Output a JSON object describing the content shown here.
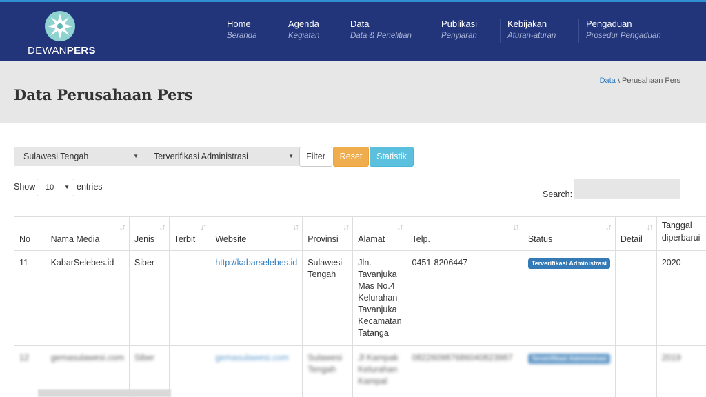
{
  "header": {
    "logo": {
      "light": "DEWAN",
      "bold": "PERS"
    },
    "nav": [
      {
        "title": "Home",
        "sub": "Beranda"
      },
      {
        "title": "Agenda",
        "sub": "Kegiatan"
      },
      {
        "title": "Data",
        "sub": "Data & Penelitian"
      },
      {
        "title": "Publikasi",
        "sub": "Penyiaran"
      },
      {
        "title": "Kebijakan",
        "sub": "Aturan-aturan"
      },
      {
        "title": "Pengaduan",
        "sub": "Prosedur Pengaduan"
      }
    ]
  },
  "page": {
    "title": "Data Perusahaan Pers",
    "breadcrumb": {
      "link": "Data",
      "separator": " \\ ",
      "current": "Perusahaan Pers"
    }
  },
  "filters": {
    "province": "Sulawesi Tengah",
    "status": "Terverifikasi Administrasi",
    "filter_label": "Filter",
    "reset_label": "Reset",
    "stat_label": "Statistik"
  },
  "length": {
    "show": "Show",
    "value": "10",
    "entries": "entries"
  },
  "search": {
    "label": "Search:",
    "value": ""
  },
  "table": {
    "headers": [
      "No",
      "Nama Media",
      "Jenis",
      "Terbit",
      "Website",
      "Provinsi",
      "Alamat",
      "Telp.",
      "Status",
      "Detail",
      "Tanggal diperbarui"
    ],
    "rows": [
      {
        "no": "11",
        "nama": "KabarSelebes.id",
        "jenis": "Siber",
        "terbit": "",
        "website": "http://kabarselebes.id",
        "provinsi": "Sulawesi Tengah",
        "alamat": "Jln. Tavanjuka Mas No.4 Kelurahan Tavanjuka Kecamatan Tatanga",
        "telp": "0451-8206447",
        "status": "Terverifikasi Administrasi",
        "detail": "",
        "tanggal": "2020"
      },
      {
        "no": "12",
        "nama": "gemasulawesi.com",
        "jenis": "Siber",
        "terbit": "",
        "website": "gemasulawesi.com",
        "provinsi": "Sulawesi Tengah",
        "alamat": "Jl Kampak Kelurahan Kampal",
        "telp": "082260987686040823987",
        "status": "Terverifikasi Administrasi",
        "detail": "",
        "tanggal": "2019"
      }
    ]
  },
  "colors": {
    "header_bg": "#22357a",
    "accent": "#2f8fd1",
    "reset": "#f0ad4e",
    "statistik": "#5bc0de",
    "badge": "#337ab7"
  }
}
